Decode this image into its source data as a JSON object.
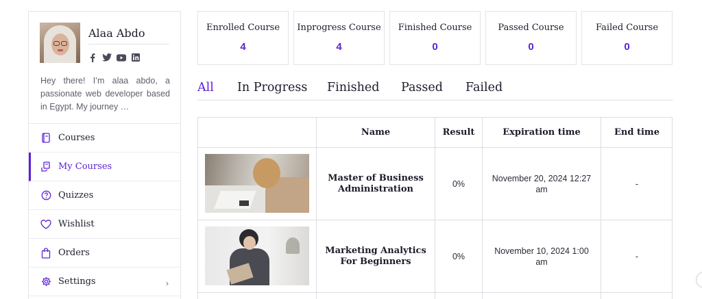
{
  "profile": {
    "name": "Alaa Abdo",
    "bio": "Hey there! I’m alaa abdo, a passionate web developer based in Egypt. My journey …",
    "socials": [
      "facebook-icon",
      "twitter-icon",
      "youtube-icon",
      "linkedin-icon"
    ]
  },
  "sidebar": {
    "items": [
      {
        "label": "Courses",
        "icon": "courses-icon"
      },
      {
        "label": "My Courses",
        "icon": "my-courses-icon",
        "active": true
      },
      {
        "label": "Quizzes",
        "icon": "quiz-icon"
      },
      {
        "label": "Wishlist",
        "icon": "heart-icon"
      },
      {
        "label": "Orders",
        "icon": "shopping-bag-icon"
      },
      {
        "label": "Settings",
        "icon": "gear-icon"
      }
    ]
  },
  "stats": [
    {
      "label": "Enrolled Course",
      "value": "4"
    },
    {
      "label": "Inprogress Course",
      "value": "4"
    },
    {
      "label": "Finished Course",
      "value": "0"
    },
    {
      "label": "Passed Course",
      "value": "0"
    },
    {
      "label": "Failed Course",
      "value": "0"
    }
  ],
  "tabs": [
    "All",
    "In Progress",
    "Finished",
    "Passed",
    "Failed"
  ],
  "active_tab": "All",
  "table": {
    "headers": [
      "",
      "Name",
      "Result",
      "Expiration time",
      "End time"
    ],
    "rows": [
      {
        "name": "Master of Business Administration",
        "result": "0%",
        "expiration": "November 20, 2024 12:27 am",
        "end": "-"
      },
      {
        "name": "Marketing Analytics For Beginners",
        "result": "0%",
        "expiration": "November 10, 2024 1:00 am",
        "end": "-"
      }
    ]
  },
  "colors": {
    "accent": "#5b21d6",
    "border": "#e3e3ea",
    "text": "#1c1c2b"
  }
}
